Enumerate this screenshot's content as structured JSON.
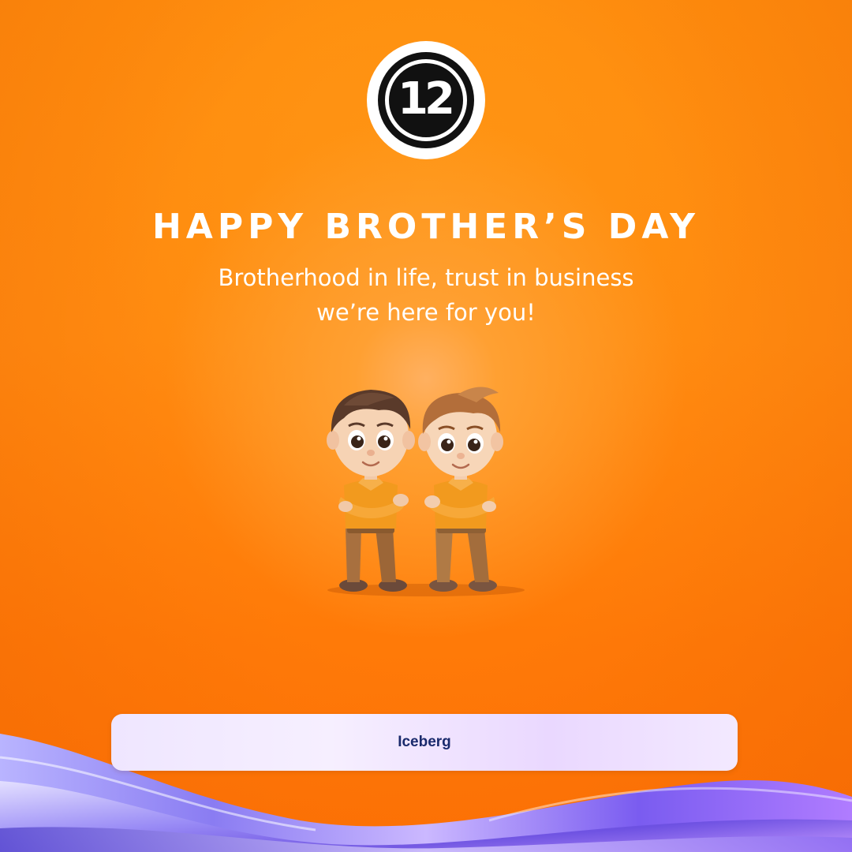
{
  "logo": {
    "text": "12",
    "icon": "number-12-badge-logo"
  },
  "headline": "HAPPY BROTHER’S DAY",
  "tagline": {
    "line1": "Brotherhood in life, trust in business",
    "line2": "we’re here for you!"
  },
  "illustration": {
    "icon": "two-cartoon-brothers-illustration"
  },
  "footer": {
    "label": "Iceberg"
  },
  "colors": {
    "background": "#ff8a10",
    "text": "#ffffff",
    "logo_black": "#111111",
    "footer_bar": "#f1e8ff",
    "footer_text": "#1a2a6c",
    "wave_purple": "#7a5cf0"
  }
}
